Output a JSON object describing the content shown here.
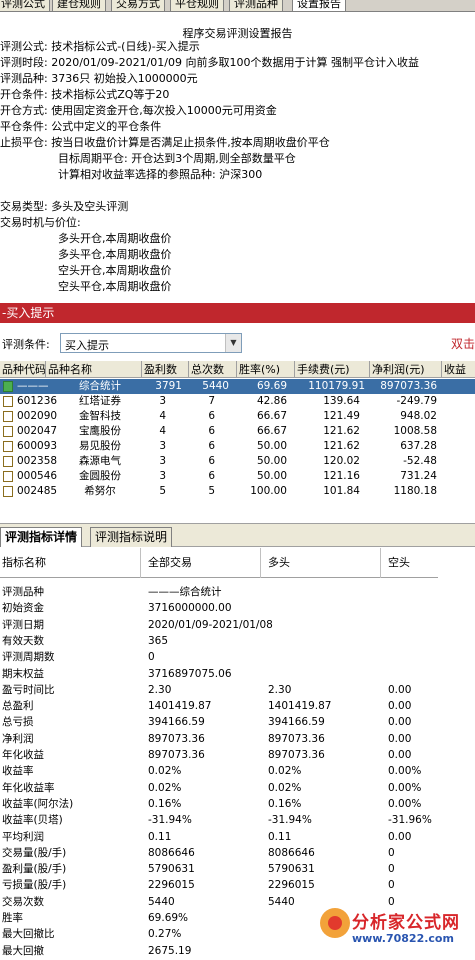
{
  "top_tabs": [
    "评测公式",
    "建仓规则",
    "交易方式",
    "平仓规则",
    "评测品种",
    "设置报告"
  ],
  "report": {
    "title": "程序交易评测设置报告",
    "lines": [
      "评测公式: 技术指标公式-(日线)-买入提示",
      "评测时段: 2020/01/09-2021/01/09 向前多取100个数据用于计算 强制平仓计入收益",
      "评测品种: 3736只 初始投入1000000元",
      "开仓条件: 技术指标公式ZQ等于20",
      "开仓方式: 使用固定资金开仓,每次投入10000元可用资金",
      "平仓条件: 公式中定义的平仓条件",
      "止损平仓: 按当日收盘价计算是否满足止损条件,按本周期收盘价平仓",
      "目标周期平仓: 开仓达到3个周期,则全部数量平仓",
      "计算相对收益率选择的参照品种: 沪深300",
      "交易类型: 多头及空头评测",
      "交易时机与价位:",
      "多头开仓,本周期收盘价",
      "多头平仓,本周期收盘价",
      "空头开仓,本周期收盘价",
      "空头平仓,本周期收盘价"
    ]
  },
  "section_bar": "-买入提示",
  "condition": {
    "label": "评测条件:",
    "value": "买入提示",
    "right_text": "双击"
  },
  "table": {
    "headers": [
      "品种代码",
      "品种名称",
      "盈利数",
      "总次数",
      "胜率(%)",
      "手续费(元)",
      "净利润(元)",
      "收益"
    ],
    "rows": [
      [
        "———",
        "综合统计",
        "3791",
        "5440",
        "69.69",
        "110179.91",
        "897073.36"
      ],
      [
        "601236",
        "红塔证券",
        "3",
        "7",
        "42.86",
        "139.64",
        "-249.79"
      ],
      [
        "002090",
        "金智科技",
        "4",
        "6",
        "66.67",
        "121.49",
        "948.02"
      ],
      [
        "002047",
        "宝鹰股份",
        "4",
        "6",
        "66.67",
        "121.62",
        "1008.58"
      ],
      [
        "600093",
        "易见股份",
        "3",
        "6",
        "50.00",
        "121.62",
        "637.28"
      ],
      [
        "002358",
        "森源电气",
        "3",
        "6",
        "50.00",
        "120.02",
        "-52.48"
      ],
      [
        "000546",
        "金圆股份",
        "3",
        "6",
        "50.00",
        "121.16",
        "731.24"
      ],
      [
        "002485",
        "希努尔",
        "5",
        "5",
        "100.00",
        "101.84",
        "1180.18"
      ]
    ]
  },
  "bottom_tabs": [
    "评测指标详情",
    "评测指标说明"
  ],
  "detail": {
    "headers": [
      "指标名称",
      "全部交易",
      "多头",
      "空头"
    ],
    "rows": [
      [
        "评测品种",
        "———综合统计",
        "",
        ""
      ],
      [
        "初始资金",
        "3716000000.00",
        "",
        ""
      ],
      [
        "评测日期",
        "2020/01/09-2021/01/08",
        "",
        ""
      ],
      [
        "有效天数",
        "365",
        "",
        ""
      ],
      [
        "评测周期数",
        "0",
        "",
        ""
      ],
      [
        "期末权益",
        "3716897075.06",
        "",
        ""
      ],
      [
        "盈亏时间比",
        "2.30",
        "2.30",
        "0.00"
      ],
      [
        "总盈利",
        "1401419.87",
        "1401419.87",
        "0.00"
      ],
      [
        "总亏损",
        "394166.59",
        "394166.59",
        "0.00"
      ],
      [
        "净利润",
        "897073.36",
        "897073.36",
        "0.00"
      ],
      [
        "年化收益",
        "897073.36",
        "897073.36",
        "0.00"
      ],
      [
        "收益率",
        "0.02%",
        "0.02%",
        "0.00%"
      ],
      [
        "年化收益率",
        "0.02%",
        "0.02%",
        "0.00%"
      ],
      [
        "收益率(阿尔法)",
        "0.16%",
        "0.16%",
        "0.00%"
      ],
      [
        "收益率(贝塔)",
        "-31.94%",
        "-31.94%",
        "-31.96%"
      ],
      [
        "平均利润",
        "0.11",
        "0.11",
        "0.00"
      ],
      [
        "交易量(股/手)",
        "8086646",
        "8086646",
        "0"
      ],
      [
        "盈利量(股/手)",
        "5790631",
        "5790631",
        "0"
      ],
      [
        "亏损量(股/手)",
        "2296015",
        "2296015",
        "0"
      ],
      [
        "交易次数",
        "5440",
        "5440",
        "0"
      ],
      [
        "胜率",
        "69.69%",
        "",
        ""
      ],
      [
        "最大回撤比",
        "0.27%",
        "",
        ""
      ],
      [
        "最大回撤",
        "2675.19",
        "",
        ""
      ]
    ]
  },
  "watermark": {
    "title": "分析家公式网",
    "url": "www.70822.com"
  }
}
